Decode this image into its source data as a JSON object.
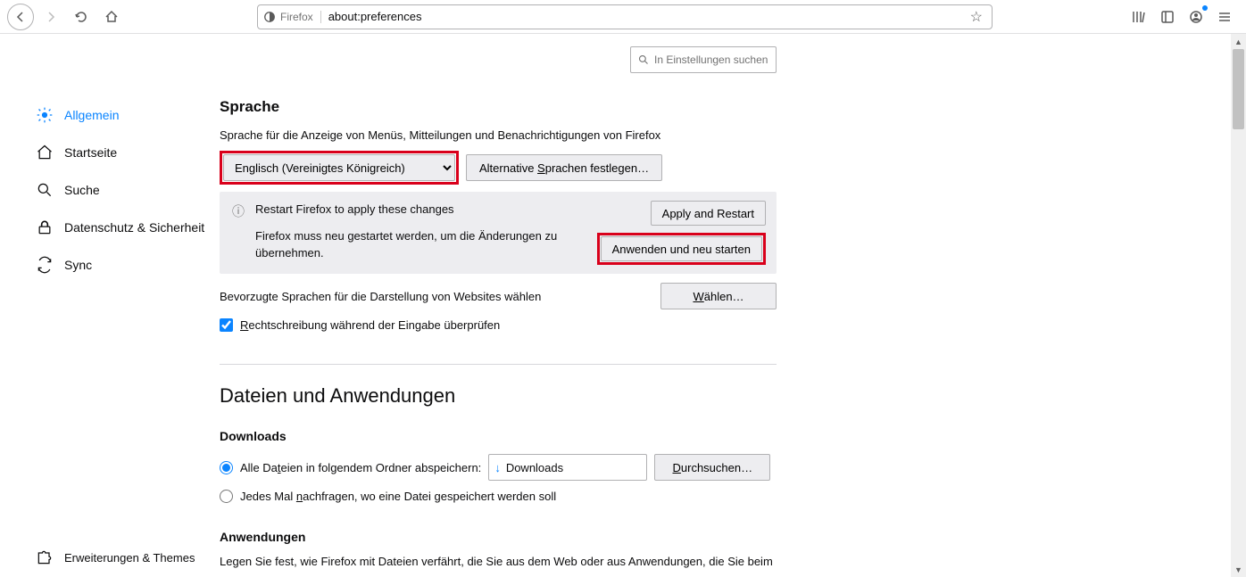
{
  "toolbar": {
    "identity": "Firefox",
    "url": "about:preferences"
  },
  "search": {
    "placeholder": "In Einstellungen suchen"
  },
  "sidebar": {
    "items": [
      {
        "label": "Allgemein"
      },
      {
        "label": "Startseite"
      },
      {
        "label": "Suche"
      },
      {
        "label": "Datenschutz & Sicherheit"
      },
      {
        "label": "Sync"
      }
    ],
    "bottom": {
      "label": "Erweiterungen & Themes"
    }
  },
  "language": {
    "heading": "Sprache",
    "desc": "Sprache für die Anzeige von Menüs, Mitteilungen und Benachrichtigungen von Firefox",
    "selected": "Englisch (Vereinigtes Königreich)",
    "alt_btn_pre": "Alternative ",
    "alt_btn_u": "S",
    "alt_btn_post": "prachen festlegen…",
    "restart1": "Restart Firefox to apply these changes",
    "restart2": "Firefox muss neu gestartet werden, um die Änderungen zu übernehmen.",
    "apply_btn": "Apply and Restart",
    "anwenden_btn": "Anwenden und neu starten",
    "pref_lang": "Bevorzugte Sprachen für die Darstellung von Websites wählen",
    "waehlen_u": "W",
    "waehlen_post": "ählen…",
    "spell_u": "R",
    "spell_post": "echtschreibung während der Eingabe überprüfen"
  },
  "files": {
    "heading": "Dateien und Anwendungen",
    "downloads_heading": "Downloads",
    "save_pre": "Alle Da",
    "save_u": "t",
    "save_post": "eien in folgendem Ordner abspeichern:",
    "folder": "Downloads",
    "browse_u": "D",
    "browse_post": "urchsuchen…",
    "ask_pre": "Jedes Mal ",
    "ask_u": "n",
    "ask_post": "achfragen, wo eine Datei gespeichert werden soll",
    "apps_heading": "Anwendungen",
    "apps_desc": "Legen Sie fest, wie Firefox mit Dateien verfährt, die Sie aus dem Web oder aus Anwendungen, die Sie beim"
  }
}
